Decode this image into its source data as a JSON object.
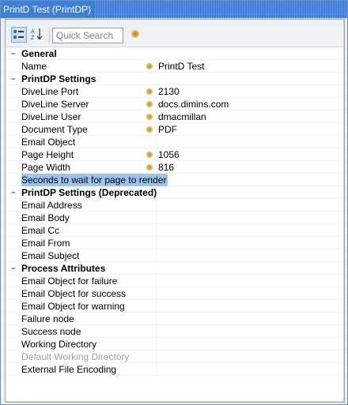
{
  "window": {
    "title": "PrintD Test (PrintDP)"
  },
  "toolbar": {
    "categorized_label": "Categorized",
    "alphabetical_label": "Alphabetical",
    "search_placeholder": "Quick Search"
  },
  "grid": {
    "general": {
      "label": "General",
      "name_label": "Name",
      "name_value": "PrintD Test"
    },
    "printdp": {
      "label": "PrintDP Settings",
      "port_label": "DiveLine Port",
      "port_value": "2130",
      "server_label": "DiveLine Server",
      "server_value": "docs.dimins.com",
      "user_label": "DiveLine User",
      "user_value": "dmacmillan",
      "doctype_label": "Document Type",
      "doctype_value": "PDF",
      "emailobj_label": "Email Object",
      "height_label": "Page Height",
      "height_value": "1056",
      "width_label": "Page Width",
      "width_value": "816",
      "seconds_label": "Seconds to wait for page to render"
    },
    "deprecated": {
      "label": "PrintDP Settings (Deprecated)",
      "addr_label": "Email Address",
      "body_label": "Email Body",
      "cc_label": "Email Cc",
      "from_label": "Email From",
      "subject_label": "Email Subject"
    },
    "process": {
      "label": "Process Attributes",
      "fail_obj_label": "Email Object for failure",
      "succ_obj_label": "Email Object for success",
      "warn_obj_label": "Email Object for warning",
      "fail_node_label": "Failure node",
      "succ_node_label": "Success node",
      "workdir_label": "Working Directory",
      "defworkdir_label": "Default Working Directory",
      "encoding_label": "External File Encoding"
    }
  }
}
